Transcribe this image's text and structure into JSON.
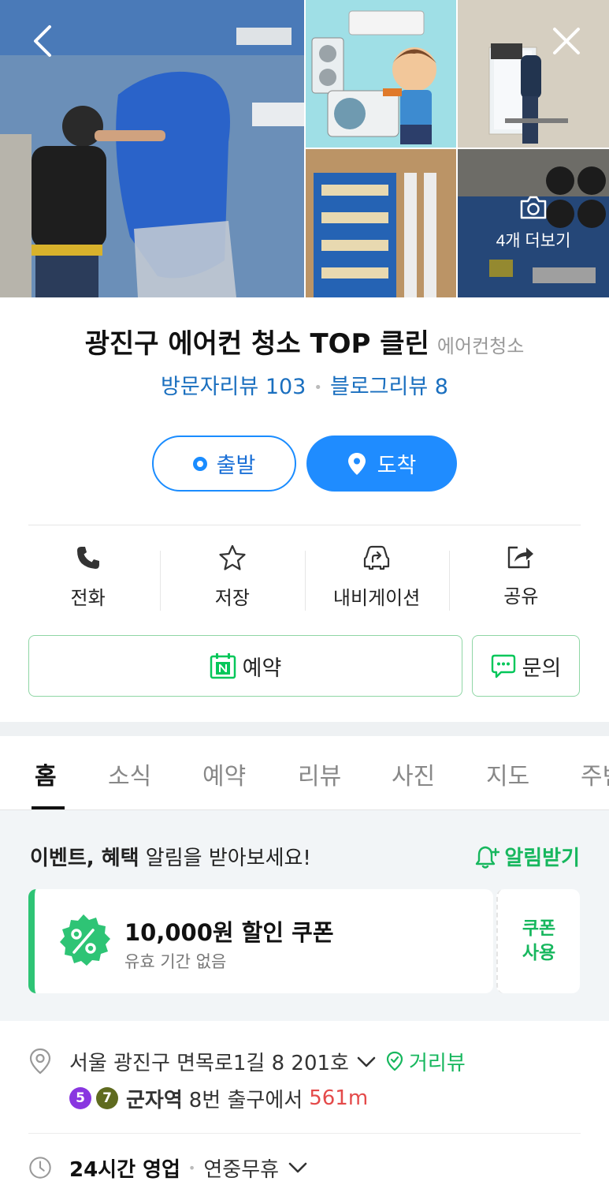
{
  "gallery": {
    "more_label": "4개 더보기"
  },
  "place": {
    "name": "광진구 에어컨 청소 TOP 클린",
    "category": "에어컨청소",
    "visitor_reviews": "방문자리뷰 103",
    "blog_reviews": "블로그리뷰 8"
  },
  "route": {
    "depart_label": "출발",
    "arrive_label": "도착"
  },
  "actions": {
    "call": "전화",
    "save": "저장",
    "navigate": "내비게이션",
    "share": "공유"
  },
  "reserve": {
    "reserve_label": "예약",
    "inquiry_label": "문의"
  },
  "tabs": [
    "홈",
    "소식",
    "예약",
    "리뷰",
    "사진",
    "지도",
    "주변"
  ],
  "event": {
    "text_bold": "이벤트, 혜택",
    "text_rest": " 알림을 받아보세요!",
    "alert_label": "알림받기"
  },
  "coupon": {
    "title": "10,000원 할인 쿠폰",
    "subtitle": "유효 기간 없음",
    "use_line1": "쿠폰",
    "use_line2": "사용"
  },
  "info": {
    "address": "서울 광진구 면목로1길 8 201호",
    "street_view": "거리뷰",
    "subway_lines": [
      "5",
      "7"
    ],
    "subway_station": "군자역",
    "subway_exit": "8번 출구에서",
    "subway_distance": "561m",
    "hours_status": "24시간 영업",
    "hours_detail": "연중무휴"
  },
  "colors": {
    "accent_blue": "#1f8cff",
    "naver_green": "#17b75e",
    "line5": "#8936e0",
    "line7": "#5f6b1f",
    "distance_red": "#e44a4a"
  }
}
